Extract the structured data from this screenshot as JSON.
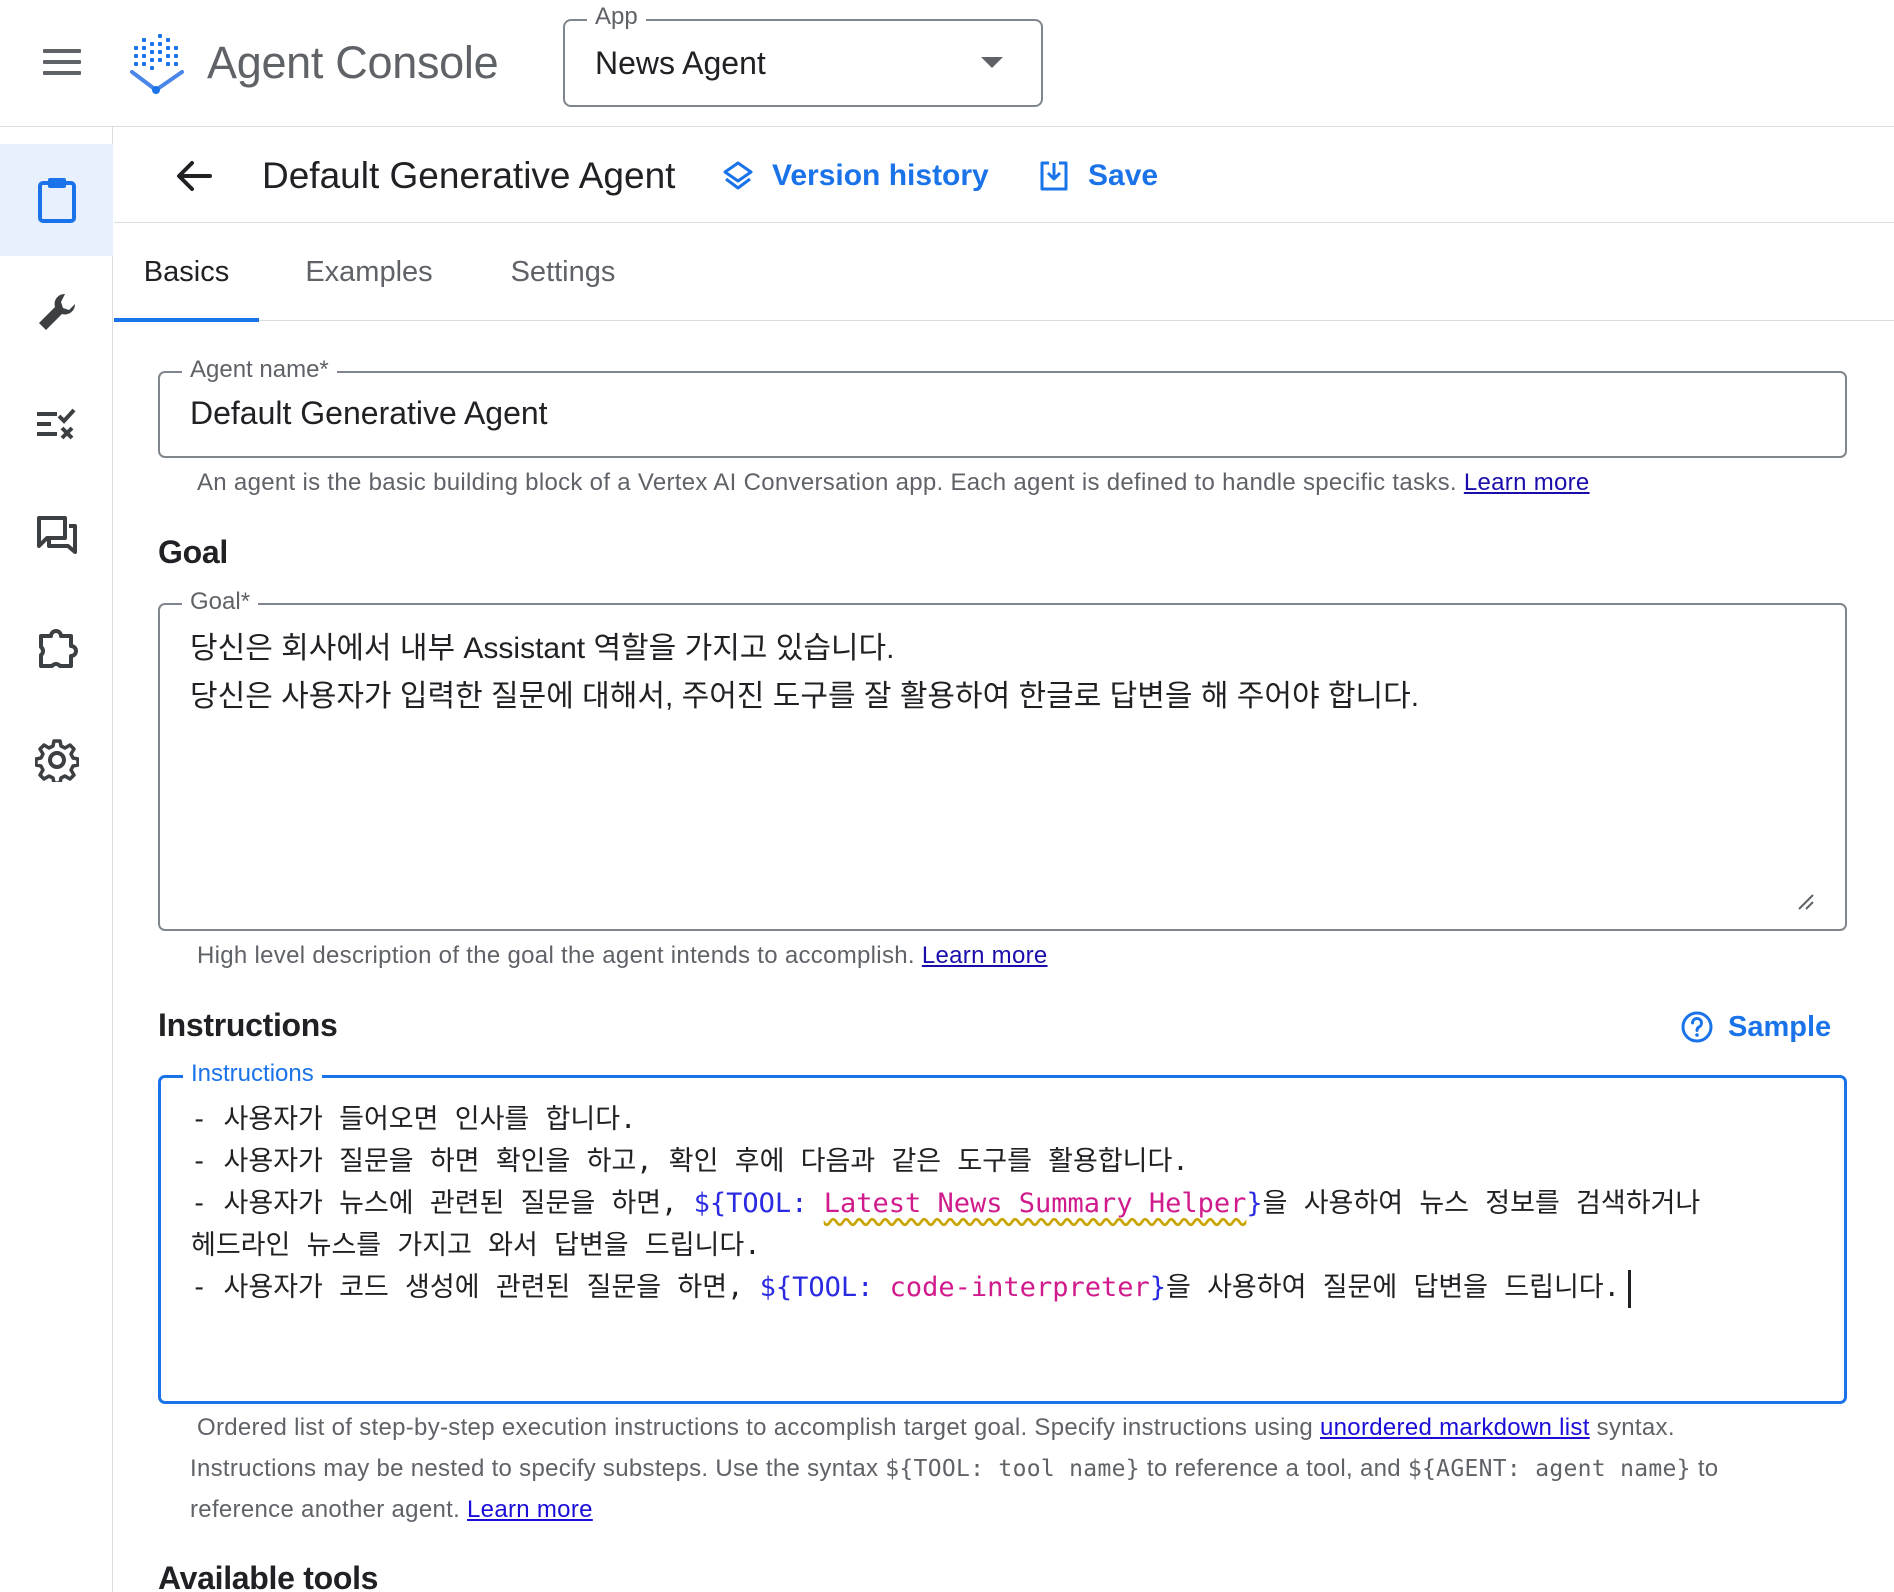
{
  "header": {
    "app_title": "Agent Console",
    "app_select": {
      "label": "App",
      "value": "News Agent"
    }
  },
  "rail": {
    "items": [
      {
        "icon": "clipboard-icon",
        "active": true
      },
      {
        "icon": "wrench-icon",
        "active": false
      },
      {
        "icon": "checklist-icon",
        "active": false
      },
      {
        "icon": "chat-icon",
        "active": false
      },
      {
        "icon": "puzzle-icon",
        "active": false
      },
      {
        "icon": "gear-icon",
        "active": false
      }
    ]
  },
  "subheader": {
    "title": "Default Generative Agent",
    "version_history_label": "Version history",
    "save_label": "Save"
  },
  "tabs": [
    {
      "label": "Basics",
      "active": true
    },
    {
      "label": "Examples",
      "active": false
    },
    {
      "label": "Settings",
      "active": false
    }
  ],
  "agent_name": {
    "label": "Agent name*",
    "value": "Default Generative Agent",
    "hint": "An agent is the basic building block of a Vertex AI Conversation app. Each agent is defined to handle specific tasks.",
    "hint_link": "Learn more"
  },
  "goal": {
    "section_title": "Goal",
    "label": "Goal*",
    "lines": [
      "당신은 회사에서 내부 Assistant 역할을 가지고 있습니다.",
      "당신은 사용자가 입력한 질문에 대해서, 주어진 도구를 잘 활용하여 한글로 답변을 해 주어야 합니다."
    ],
    "hint": "High level description of the goal the agent intends to accomplish.",
    "hint_link": "Learn more"
  },
  "instructions": {
    "section_title": "Instructions",
    "sample_label": "Sample",
    "label": "Instructions",
    "line1": "- 사용자가 들어오면 인사를 합니다.",
    "line2": "- 사용자가 질문을 하면 확인을 하고, 확인 후에 다음과 같은 도구를 활용합니다.",
    "line3_prefix": "- 사용자가 뉴스에 관련된 질문을 하면, ",
    "tool1_open": "${TOOL:",
    "tool1_name": "Latest News Summary Helper",
    "tool1_close": "}",
    "line3_suffix": "을 사용하여 뉴스 정보를 검색하거나",
    "line4": "헤드라인 뉴스를 가지고 와서 답변을 드립니다.",
    "line5_prefix": "- 사용자가 코드 생성에 관련된 질문을 하면, ",
    "tool2_open": "${TOOL:",
    "tool2_name": "code-interpreter",
    "tool2_close": "}",
    "line5_suffix": "을 사용하여 질문에 답변을 드립니다.",
    "hint_part1": "Ordered list of step-by-step execution instructions to accomplish target goal. Specify instructions using",
    "hint_link1": "unordered markdown list",
    "hint_part2": "syntax.",
    "hint_part3": "Instructions may be nested to specify substeps. Use the syntax",
    "hint_code1": "${TOOL: tool name}",
    "hint_part4": "to reference a tool, and",
    "hint_code2": "${AGENT: agent name}",
    "hint_part5": "to",
    "hint_part6": "reference another agent.",
    "hint_link2": "Learn more"
  },
  "available_tools": {
    "section_title": "Available tools"
  },
  "colors": {
    "accent": "#1a73e8",
    "active_rail_bg": "#e8f0fe",
    "tool_keyword": "#2a2ae0",
    "tool_name": "#d01b8d"
  }
}
